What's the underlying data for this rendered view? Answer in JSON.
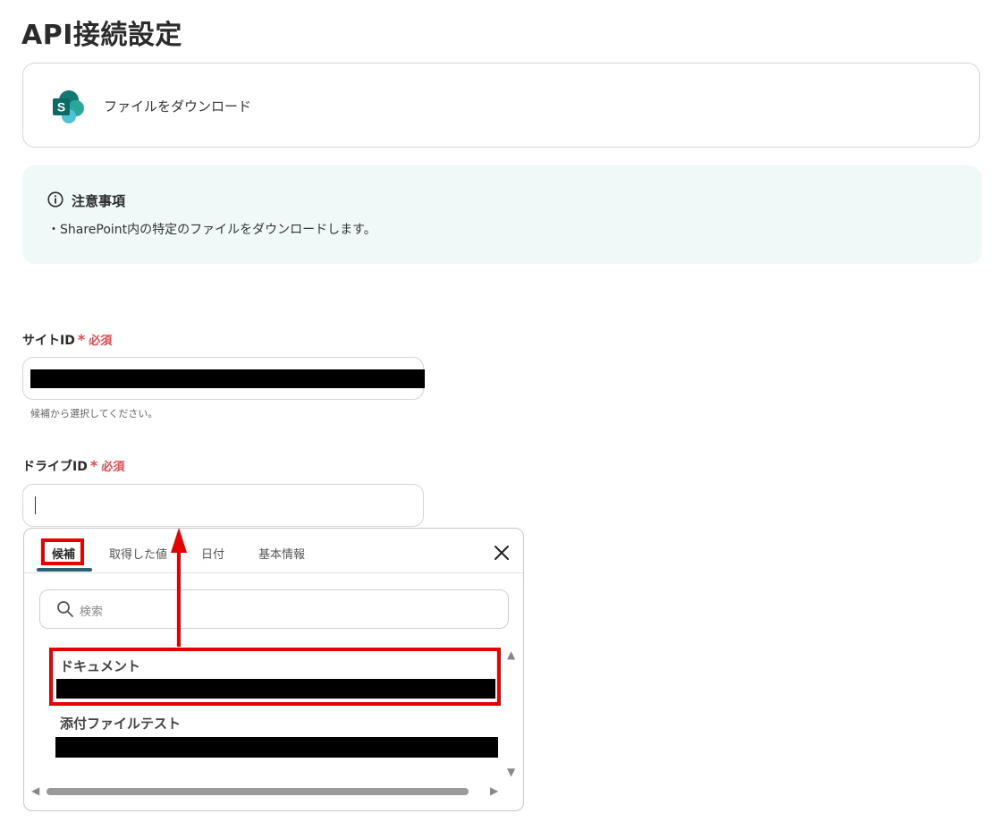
{
  "page": {
    "title": "API接続設定"
  },
  "action": {
    "label": "ファイルをダウンロード",
    "icon": "sharepoint-icon"
  },
  "notice": {
    "title": "注意事項",
    "text": "・SharePoint内の特定のファイルをダウンロードします。"
  },
  "fields": {
    "site_id": {
      "label": "サイトID",
      "required": "必須",
      "hint": "候補から選択してください。"
    },
    "drive_id": {
      "label": "ドライブID",
      "required": "必須"
    }
  },
  "picker": {
    "tabs": [
      "候補",
      "取得した値",
      "日付",
      "基本情報"
    ],
    "active_tab": "候補",
    "search_placeholder": "検索",
    "options": [
      {
        "title": "ドキュメント"
      },
      {
        "title": "添付ファイルテスト"
      }
    ]
  },
  "colors": {
    "accent": "#2d5f72",
    "required": "#e5484d",
    "annotation": "#e60000",
    "notice_bg": "#eff9f8"
  }
}
